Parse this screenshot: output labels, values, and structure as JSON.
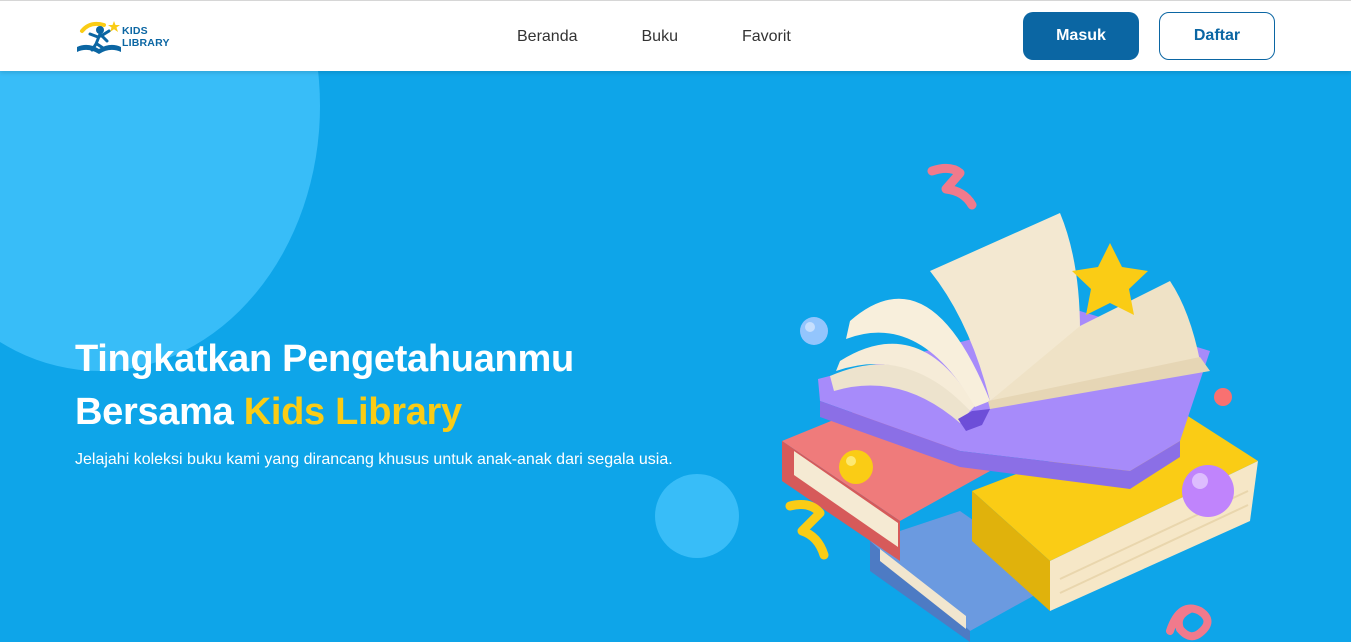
{
  "brand": {
    "line1": "KIDS",
    "line2": "LIBRARY"
  },
  "nav": {
    "items": [
      {
        "label": "Beranda"
      },
      {
        "label": "Buku"
      },
      {
        "label": "Favorit"
      }
    ]
  },
  "auth": {
    "login_label": "Masuk",
    "register_label": "Daftar"
  },
  "hero": {
    "headline_line1": "Tingkatkan Pengetahuanmu",
    "headline_line2_prefix": "Bersama ",
    "headline_line2_accent": "Kids Library",
    "subtitle": "Jelajahi koleksi buku kami yang dirancang khusus untuk anak-anak dari segala usia."
  },
  "colors": {
    "primary": "#0b66a3",
    "hero_bg": "#0ea5e9",
    "bubble": "#38bdf8",
    "accent": "#facc15"
  },
  "icons": {
    "logo": "kids-library-logo-icon",
    "illustration": "books-stack-illustration"
  }
}
